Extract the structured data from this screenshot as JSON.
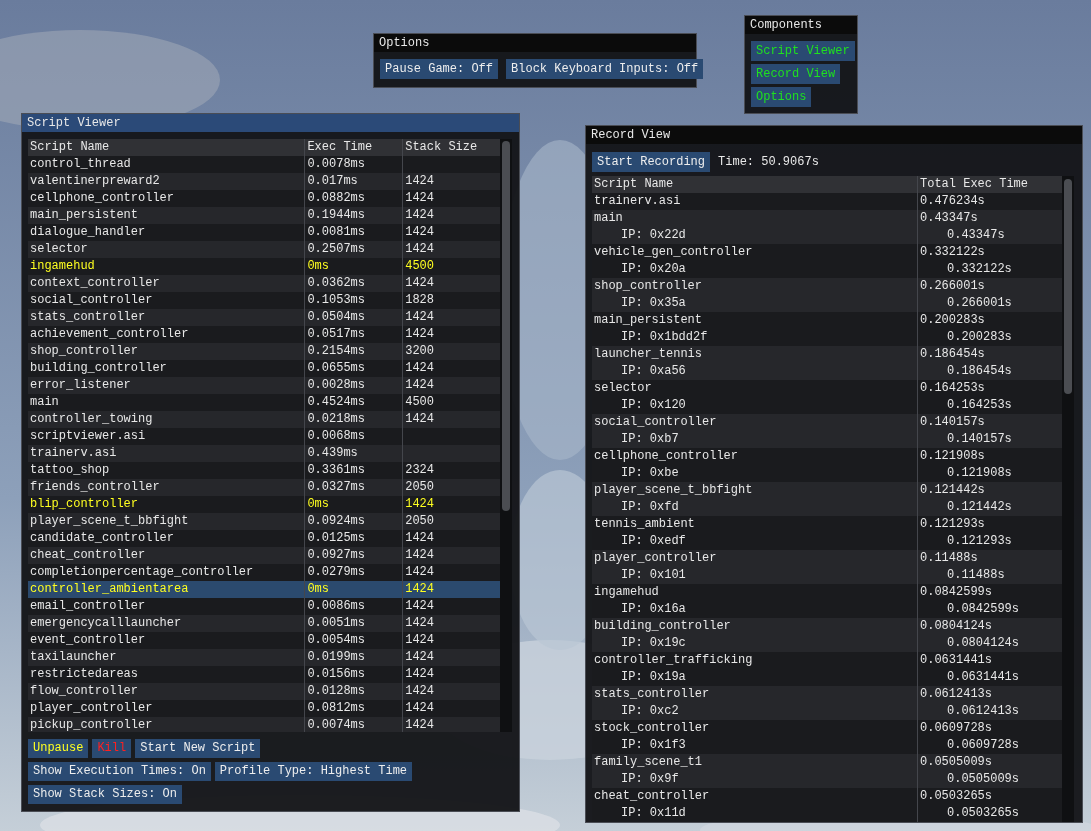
{
  "options_window": {
    "title": "Options",
    "focused": false,
    "buttons": [
      {
        "label": "Pause Game: Off"
      },
      {
        "label": "Block Keyboard Inputs: Off"
      }
    ]
  },
  "components_window": {
    "title": "Components",
    "focused": false,
    "buttons": [
      {
        "label": "Script Viewer",
        "open": true
      },
      {
        "label": "Record View",
        "open": true
      },
      {
        "label": "Options",
        "open": true
      }
    ]
  },
  "script_viewer": {
    "title": "Script Viewer",
    "focused": true,
    "columns": [
      "Script Name",
      "Exec Time",
      "Stack Size"
    ],
    "rows": [
      {
        "name": "control_thread",
        "exec_time": "0.0078ms",
        "stack_size": "",
        "highlighted": false,
        "selected": false
      },
      {
        "name": "valentinerpreward2",
        "exec_time": "0.017ms",
        "stack_size": "1424",
        "highlighted": false,
        "selected": false
      },
      {
        "name": "cellphone_controller",
        "exec_time": "0.0882ms",
        "stack_size": "1424",
        "highlighted": false,
        "selected": false
      },
      {
        "name": "main_persistent",
        "exec_time": "0.1944ms",
        "stack_size": "1424",
        "highlighted": false,
        "selected": false
      },
      {
        "name": "dialogue_handler",
        "exec_time": "0.0081ms",
        "stack_size": "1424",
        "highlighted": false,
        "selected": false
      },
      {
        "name": "selector",
        "exec_time": "0.2507ms",
        "stack_size": "1424",
        "highlighted": false,
        "selected": false
      },
      {
        "name": "ingamehud",
        "exec_time": "0ms",
        "stack_size": "4500",
        "highlighted": true,
        "selected": false
      },
      {
        "name": "context_controller",
        "exec_time": "0.0362ms",
        "stack_size": "1424",
        "highlighted": false,
        "selected": false
      },
      {
        "name": "social_controller",
        "exec_time": "0.1053ms",
        "stack_size": "1828",
        "highlighted": false,
        "selected": false
      },
      {
        "name": "stats_controller",
        "exec_time": "0.0504ms",
        "stack_size": "1424",
        "highlighted": false,
        "selected": false
      },
      {
        "name": "achievement_controller",
        "exec_time": "0.0517ms",
        "stack_size": "1424",
        "highlighted": false,
        "selected": false
      },
      {
        "name": "shop_controller",
        "exec_time": "0.2154ms",
        "stack_size": "3200",
        "highlighted": false,
        "selected": false
      },
      {
        "name": "building_controller",
        "exec_time": "0.0655ms",
        "stack_size": "1424",
        "highlighted": false,
        "selected": false
      },
      {
        "name": "error_listener",
        "exec_time": "0.0028ms",
        "stack_size": "1424",
        "highlighted": false,
        "selected": false
      },
      {
        "name": "main",
        "exec_time": "0.4524ms",
        "stack_size": "4500",
        "highlighted": false,
        "selected": false
      },
      {
        "name": "controller_towing",
        "exec_time": "0.0218ms",
        "stack_size": "1424",
        "highlighted": false,
        "selected": false
      },
      {
        "name": "scriptviewer.asi",
        "exec_time": "0.0068ms",
        "stack_size": "",
        "highlighted": false,
        "selected": false
      },
      {
        "name": "trainerv.asi",
        "exec_time": "0.439ms",
        "stack_size": "",
        "highlighted": false,
        "selected": false
      },
      {
        "name": "tattoo_shop",
        "exec_time": "0.3361ms",
        "stack_size": "2324",
        "highlighted": false,
        "selected": false
      },
      {
        "name": "friends_controller",
        "exec_time": "0.0327ms",
        "stack_size": "2050",
        "highlighted": false,
        "selected": false
      },
      {
        "name": "blip_controller",
        "exec_time": "0ms",
        "stack_size": "1424",
        "highlighted": true,
        "selected": false
      },
      {
        "name": "player_scene_t_bbfight",
        "exec_time": "0.0924ms",
        "stack_size": "2050",
        "highlighted": false,
        "selected": false
      },
      {
        "name": "candidate_controller",
        "exec_time": "0.0125ms",
        "stack_size": "1424",
        "highlighted": false,
        "selected": false
      },
      {
        "name": "cheat_controller",
        "exec_time": "0.0927ms",
        "stack_size": "1424",
        "highlighted": false,
        "selected": false
      },
      {
        "name": "completionpercentage_controller",
        "exec_time": "0.0279ms",
        "stack_size": "1424",
        "highlighted": false,
        "selected": false
      },
      {
        "name": "controller_ambientarea",
        "exec_time": "0ms",
        "stack_size": "1424",
        "highlighted": true,
        "selected": true
      },
      {
        "name": "email_controller",
        "exec_time": "0.0086ms",
        "stack_size": "1424",
        "highlighted": false,
        "selected": false
      },
      {
        "name": "emergencycalllauncher",
        "exec_time": "0.0051ms",
        "stack_size": "1424",
        "highlighted": false,
        "selected": false
      },
      {
        "name": "event_controller",
        "exec_time": "0.0054ms",
        "stack_size": "1424",
        "highlighted": false,
        "selected": false
      },
      {
        "name": "taxilauncher",
        "exec_time": "0.0199ms",
        "stack_size": "1424",
        "highlighted": false,
        "selected": false
      },
      {
        "name": "restrictedareas",
        "exec_time": "0.0156ms",
        "stack_size": "1424",
        "highlighted": false,
        "selected": false
      },
      {
        "name": "flow_controller",
        "exec_time": "0.0128ms",
        "stack_size": "1424",
        "highlighted": false,
        "selected": false
      },
      {
        "name": "player_controller",
        "exec_time": "0.0812ms",
        "stack_size": "1424",
        "highlighted": false,
        "selected": false
      },
      {
        "name": "pickup_controller",
        "exec_time": "0.0074ms",
        "stack_size": "1424",
        "highlighted": false,
        "selected": false
      }
    ],
    "button_rows": [
      [
        {
          "label": "Unpause",
          "kind": "warning"
        },
        {
          "label": "Kill",
          "kind": "danger"
        },
        {
          "label": "Start New Script",
          "kind": "normal"
        }
      ],
      [
        {
          "label": "Show Execution Times: On",
          "kind": "normal"
        },
        {
          "label": "Profile Type: Highest Time",
          "kind": "normal"
        }
      ],
      [
        {
          "label": "Show Stack Sizes: On",
          "kind": "normal"
        }
      ]
    ]
  },
  "record_view": {
    "title": "Record View",
    "focused": false,
    "record_button": "Start Recording",
    "time": "Time: 50.9067s",
    "columns": [
      "Script Name",
      "Total Exec Time"
    ],
    "rows": [
      {
        "name": "trainerv.asi",
        "total": "0.476234s"
      },
      {
        "name": "main",
        "total": "0.43347s",
        "ip": "IP: 0x22d",
        "ip_time": "0.43347s"
      },
      {
        "name": "vehicle_gen_controller",
        "total": "0.332122s",
        "ip": "IP: 0x20a",
        "ip_time": "0.332122s"
      },
      {
        "name": "shop_controller",
        "total": "0.266001s",
        "ip": "IP: 0x35a",
        "ip_time": "0.266001s"
      },
      {
        "name": "main_persistent",
        "total": "0.200283s",
        "ip": "IP: 0x1bdd2f",
        "ip_time": "0.200283s"
      },
      {
        "name": "launcher_tennis",
        "total": "0.186454s",
        "ip": "IP: 0xa56",
        "ip_time": "0.186454s"
      },
      {
        "name": "selector",
        "total": "0.164253s",
        "ip": "IP: 0x120",
        "ip_time": "0.164253s"
      },
      {
        "name": "social_controller",
        "total": "0.140157s",
        "ip": "IP: 0xb7",
        "ip_time": "0.140157s"
      },
      {
        "name": "cellphone_controller",
        "total": "0.121908s",
        "ip": "IP: 0xbe",
        "ip_time": "0.121908s"
      },
      {
        "name": "player_scene_t_bbfight",
        "total": "0.121442s",
        "ip": "IP: 0xfd",
        "ip_time": "0.121442s"
      },
      {
        "name": "tennis_ambient",
        "total": "0.121293s",
        "ip": "IP: 0xedf",
        "ip_time": "0.121293s"
      },
      {
        "name": "player_controller",
        "total": "0.11488s",
        "ip": "IP: 0x101",
        "ip_time": "0.11488s"
      },
      {
        "name": "ingamehud",
        "total": "0.0842599s",
        "ip": "IP: 0x16a",
        "ip_time": "0.0842599s"
      },
      {
        "name": "building_controller",
        "total": "0.0804124s",
        "ip": "IP: 0x19c",
        "ip_time": "0.0804124s"
      },
      {
        "name": "controller_trafficking",
        "total": "0.0631441s",
        "ip": "IP: 0x19a",
        "ip_time": "0.0631441s"
      },
      {
        "name": "stats_controller",
        "total": "0.0612413s",
        "ip": "IP: 0xc2",
        "ip_time": "0.0612413s"
      },
      {
        "name": "stock_controller",
        "total": "0.0609728s",
        "ip": "IP: 0x1f3",
        "ip_time": "0.0609728s"
      },
      {
        "name": "family_scene_t1",
        "total": "0.0505009s",
        "ip": "IP: 0x9f",
        "ip_time": "0.0505009s"
      },
      {
        "name": "cheat_controller",
        "total": "0.0503265s",
        "ip": "IP: 0x11d",
        "ip_time": "0.0503265s"
      }
    ]
  }
}
